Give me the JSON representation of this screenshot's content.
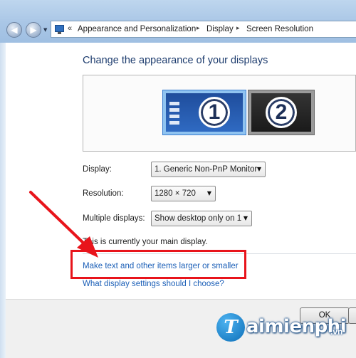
{
  "breadcrumb": {
    "overflow": "«",
    "items": [
      "Appearance and Personalization",
      "Display",
      "Screen Resolution"
    ],
    "separator": "▸"
  },
  "nav": {
    "back": "◀",
    "forward": "▶",
    "dropdown": "▼"
  },
  "heading": "Change the appearance of your displays",
  "monitors": [
    {
      "number": "1",
      "selected": true
    },
    {
      "number": "2",
      "selected": false
    }
  ],
  "settings": {
    "display": {
      "label": "Display:",
      "value": "1. Generic Non-PnP Monitor"
    },
    "resolution": {
      "label": "Resolution:",
      "value": "1280 × 720"
    },
    "multiple": {
      "label": "Multiple displays:",
      "value": "Show desktop only on 1"
    }
  },
  "info_text": "This is currently your main display.",
  "links": {
    "text_size": "Make text and other items larger or smaller",
    "help": "What display settings should I choose?"
  },
  "buttons": {
    "ok": "OK"
  },
  "watermark": {
    "mark": "T",
    "name": "aimienphi",
    "tld": ".vn"
  },
  "colors": {
    "link": "#1b5fb7",
    "heading": "#1d3c6e",
    "annotation": "#e8141b"
  }
}
